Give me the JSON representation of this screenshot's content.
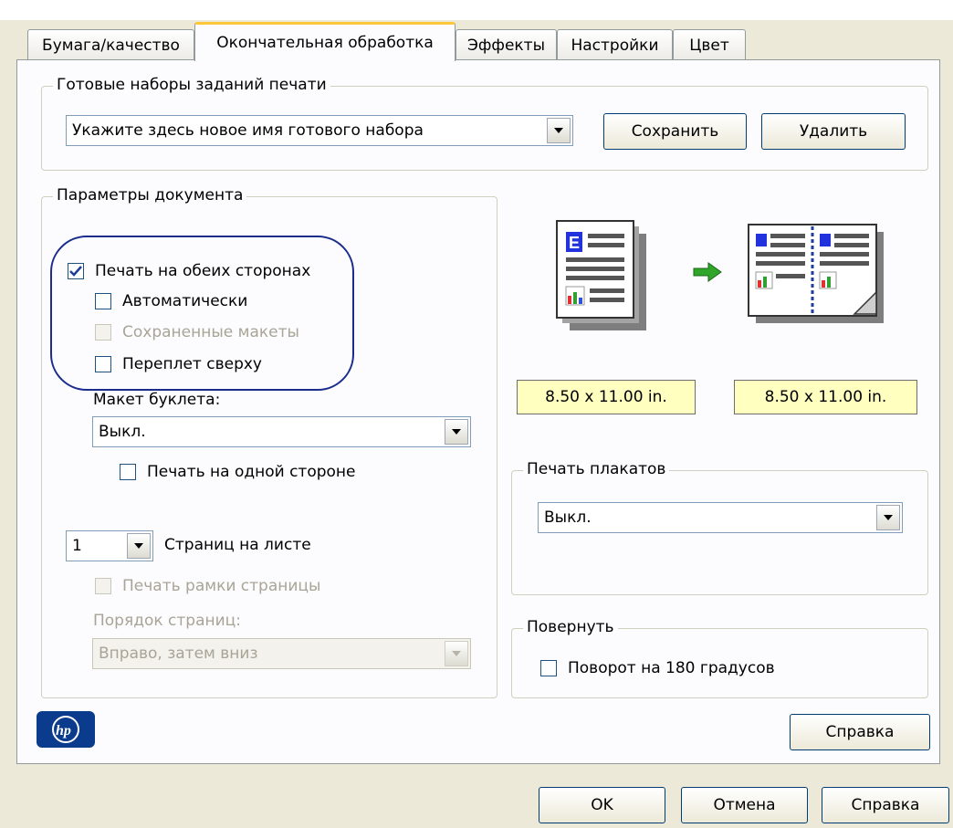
{
  "tabs": [
    {
      "label": "Бумага/качество"
    },
    {
      "label": "Окончательная обработка"
    },
    {
      "label": "Эффекты"
    },
    {
      "label": "Настройки"
    },
    {
      "label": "Цвет"
    }
  ],
  "presets": {
    "group_label": "Готовые наборы заданий печати",
    "combo_value": "Укажите здесь новое имя готового набора",
    "save_button": "Сохранить",
    "delete_button": "Удалить"
  },
  "document_options": {
    "group_label": "Параметры документа",
    "print_both_sides": "Печать на обеих сторонах",
    "print_both_sides_checked": true,
    "automatic": "Автоматически",
    "saved_layouts": "Сохраненные макеты",
    "flip_pages_up": "Переплет сверху",
    "booklet_layout_label": "Макет буклета:",
    "booklet_layout_value": "Выкл.",
    "print_one_side": "Печать на одной стороне",
    "pages_per_sheet_value": "1",
    "pages_per_sheet_label": "Страниц на листе",
    "print_page_borders": "Печать рамки страницы",
    "page_order_label": "Порядок страниц:",
    "page_order_value": "Вправо, затем вниз"
  },
  "preview": {
    "source_size": "8.50 x 11.00 in.",
    "target_size": "8.50 x 11.00 in."
  },
  "poster": {
    "group_label": "Печать плакатов",
    "value": "Выкл."
  },
  "rotate": {
    "group_label": "Повернуть",
    "rotate_180": "Поворот на 180 градусов"
  },
  "help_inner": "Справка",
  "footer": {
    "ok": "OK",
    "cancel": "Отмена",
    "help": "Справка"
  },
  "colors": {
    "accent_tab": "#ffc83c",
    "highlight_ellipse": "#1a2c8c",
    "size_box": "#ffffc0",
    "arrow_green": "#2fa52a",
    "hp_blue": "#0b3b8c"
  }
}
